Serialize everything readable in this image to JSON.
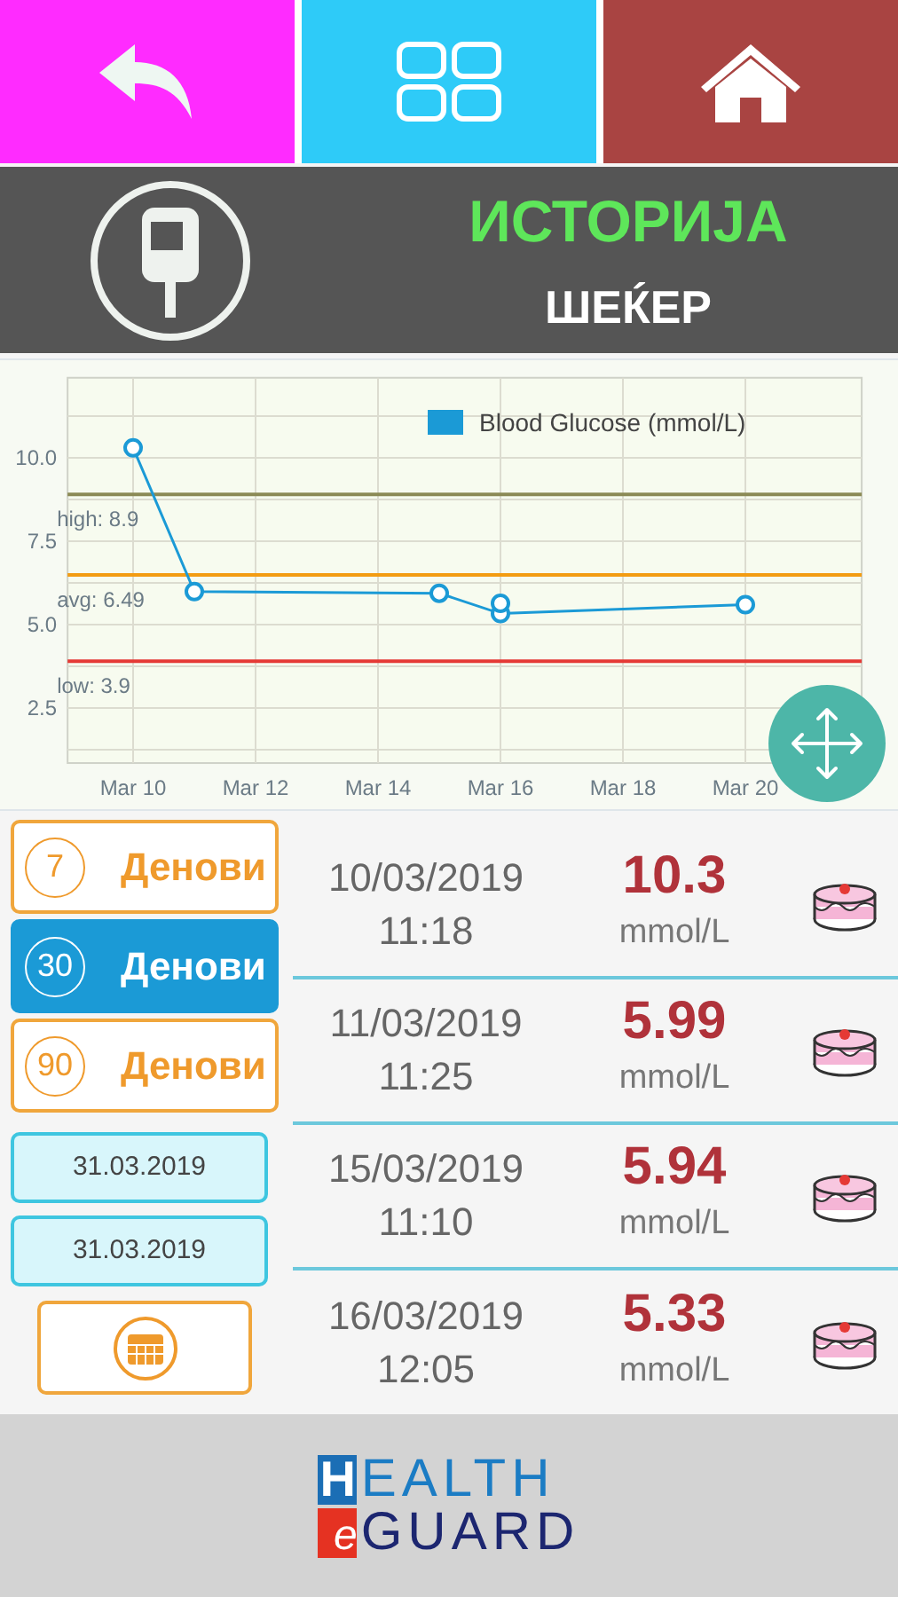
{
  "header": {
    "title": "ИСТОРИЈА",
    "subtitle": "ШЕЌЕР"
  },
  "chart": {
    "chart_data": {
      "type": "line",
      "series": [
        {
          "name": "Blood Glucose (mmol/L)",
          "color": "#1b9ad6",
          "marker": "o",
          "values": [
            null,
            10.3,
            5.99,
            null,
            null,
            null,
            5.94,
            5.33,
            null,
            null,
            null,
            5.6,
            null
          ]
        },
        {
          "color": "#1b9ad6",
          "marker": "o",
          "values": [
            null,
            null,
            null,
            null,
            null,
            null,
            null,
            5.64,
            null,
            null,
            null,
            null,
            null
          ]
        }
      ],
      "grid": true,
      "categories": [
        null,
        "Mar 10",
        null,
        "Mar 12",
        null,
        "Mar 14",
        null,
        "Mar 16",
        null,
        "Mar 18",
        null,
        "Mar 20",
        null
      ],
      "ylim": [
        0.85,
        12.4
      ],
      "yticks": [
        {
          "value": 2.5,
          "label": "2.5"
        },
        {
          "value": 5,
          "label": "5.0"
        },
        {
          "value": 7.5,
          "label": "7.5"
        },
        {
          "value": 10,
          "label": "10.0"
        }
      ],
      "ref_lines": [
        {
          "axis": "y",
          "label": "high: 8.9",
          "value": 8.9,
          "color": "#8b8a55"
        },
        {
          "axis": "y",
          "label": "avg: 6.49",
          "value": 6.49,
          "color": "#f39c12"
        },
        {
          "axis": "y",
          "label": "low: 3.9",
          "value": 3.9,
          "color": "#e53935"
        }
      ]
    }
  },
  "periods": [
    {
      "number": "7",
      "label": "Денови",
      "selected": false
    },
    {
      "number": "30",
      "label": "Денови",
      "selected": true
    },
    {
      "number": "90",
      "label": "Денови",
      "selected": false
    }
  ],
  "date_range": [
    "31.03.2019",
    "31.03.2019"
  ],
  "readings": [
    {
      "date": "10/03/2019",
      "time": "11:18",
      "value": "10.3",
      "unit": "mmol/L"
    },
    {
      "date": "11/03/2019",
      "time": "11:25",
      "value": "5.99",
      "unit": "mmol/L"
    },
    {
      "date": "15/03/2019",
      "time": "11:10",
      "value": "5.94",
      "unit": "mmol/L"
    },
    {
      "date": "16/03/2019",
      "time": "12:05",
      "value": "5.33",
      "unit": "mmol/L"
    }
  ],
  "logo": {
    "first_letter": "H",
    "first_rest": "EALTH",
    "second_letter": "e",
    "second_rest": "GUARD"
  }
}
